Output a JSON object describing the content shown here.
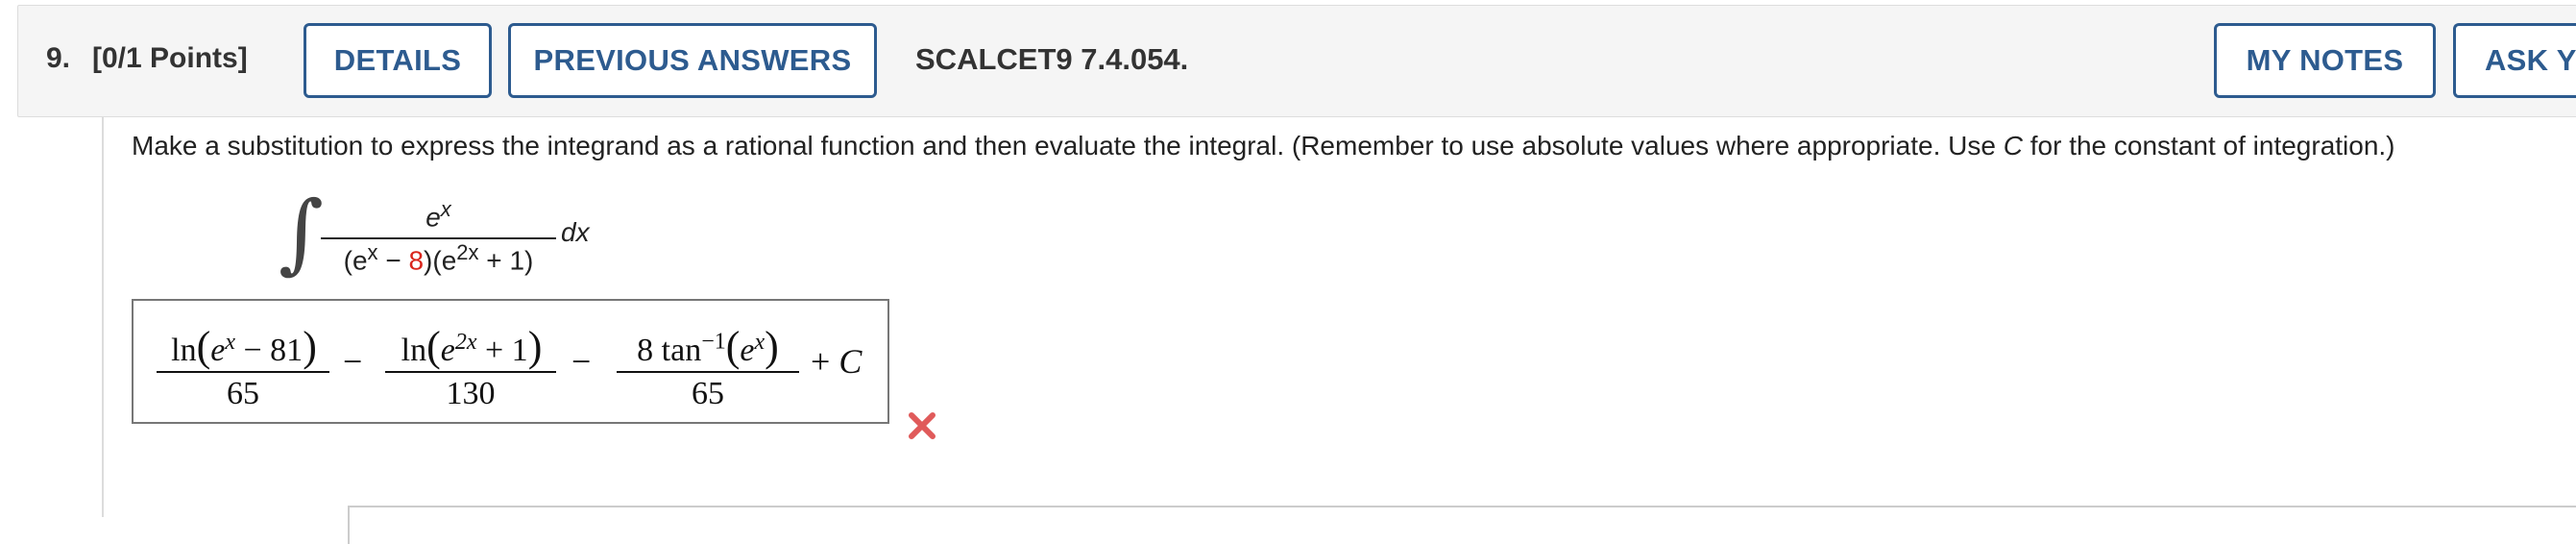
{
  "question": {
    "number": "9.",
    "points": "[0/1 Points]",
    "id": "SCALCET9 7.4.054."
  },
  "buttons": {
    "details": "DETAILS",
    "previous_answers": "PREVIOUS ANSWERS",
    "my_notes": "MY NOTES",
    "ask": "ASK YO"
  },
  "prompt": {
    "before_c": "Make a substitution to express the integrand as a rational function and then evaluate the integral. (Remember to use absolute values where appropriate. Use ",
    "c": "C",
    "after_c": " for the constant of integration.)"
  },
  "integral": {
    "numerator_base": "e",
    "numerator_exp": "x",
    "den_open": "(e",
    "den_exp1": "x",
    "den_minus": " − ",
    "den_const": "8",
    "den_mid": ")(e",
    "den_exp2": "2x",
    "den_close": " + 1)",
    "dx": "dx"
  },
  "answer": {
    "t1_num_pre": "ln",
    "t1_num_inner": "e",
    "t1_num_exp": "x",
    "t1_num_post": " − 81",
    "t1_den": "65",
    "minus1": "−",
    "t2_num_pre": "ln",
    "t2_num_inner": "e",
    "t2_num_exp": "2x",
    "t2_num_post": " + 1",
    "t2_den": "130",
    "minus2": "−",
    "t3_num_pre": "8 tan",
    "t3_num_sup": "−1",
    "t3_num_inner": "e",
    "t3_num_exp": "x",
    "t3_den": "65",
    "plus_c": "+ C"
  },
  "status": {
    "icon": "wrong-x-icon",
    "color": "#e05a5a"
  },
  "colors": {
    "button_border": "#2d5b8f",
    "highlight": "#d9251c"
  }
}
